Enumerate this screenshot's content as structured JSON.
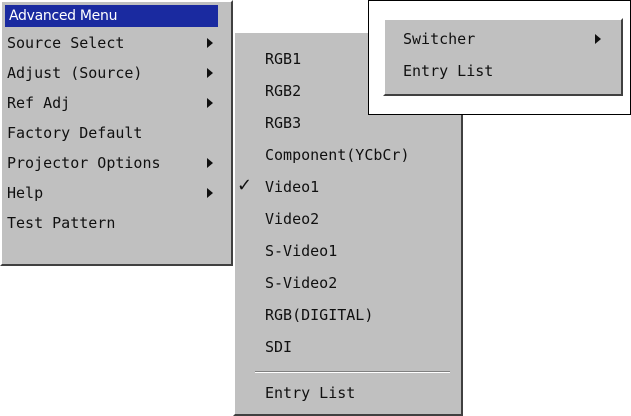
{
  "main_menu": {
    "title": "Advanced Menu",
    "items": [
      {
        "label": "Source Select",
        "has_submenu": true
      },
      {
        "label": "Adjust (Source)",
        "has_submenu": true
      },
      {
        "label": "Ref Adj",
        "has_submenu": true
      },
      {
        "label": "Factory Default",
        "has_submenu": false
      },
      {
        "label": "Projector Options",
        "has_submenu": true
      },
      {
        "label": "Help",
        "has_submenu": true
      },
      {
        "label": "Test Pattern",
        "has_submenu": false
      }
    ]
  },
  "source_menu": {
    "items": [
      {
        "label": "RGB1"
      },
      {
        "label": "RGB2"
      },
      {
        "label": "RGB3"
      },
      {
        "label": "Component(YCbCr)"
      },
      {
        "label": "Video1",
        "checked": true
      },
      {
        "label": "Video2"
      },
      {
        "label": "S-Video1"
      },
      {
        "label": "S-Video2"
      },
      {
        "label": "RGB(DIGITAL)"
      },
      {
        "label": "SDI"
      },
      {
        "label": "Entry List"
      }
    ],
    "check_glyph": "✓"
  },
  "aux_menu": {
    "items": [
      {
        "label": "Switcher",
        "has_submenu": true
      },
      {
        "label": "Entry List",
        "has_submenu": false
      }
    ]
  },
  "colors": {
    "menu_bg": "#c0c0c0",
    "title_bg": "#1a2aa0",
    "title_text": "#ffffff",
    "text": "#101010"
  }
}
